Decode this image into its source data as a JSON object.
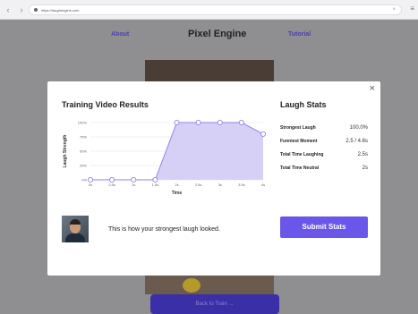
{
  "browser": {
    "url": "https://laughengine.com",
    "back_glyph": "‹",
    "forward_glyph": "›",
    "close_glyph": "×",
    "menu_glyph": "≡"
  },
  "page": {
    "nav_about": "About",
    "nav_title": "Pixel Engine",
    "nav_tutorial": "Tutorial",
    "bottom_button": "Back to Train →"
  },
  "modal": {
    "close_glyph": "×",
    "results_title": "Training Video Results",
    "stats_title": "Laugh Stats",
    "caption": "This is how your strongest laugh looked.",
    "submit_label": "Submit Stats",
    "stats": [
      {
        "label": "Strongest Laugh",
        "value": "100.0%"
      },
      {
        "label": "Funniest Moment",
        "value": "2.5 / 4.6s"
      },
      {
        "label": "Total Time Laughing",
        "value": "2.5s"
      },
      {
        "label": "Total Time Neutral",
        "value": "2s"
      }
    ]
  },
  "chart_data": {
    "type": "area",
    "xlabel": "Time",
    "ylabel": "Laugh Strength",
    "x": [
      "0s",
      "0.5s",
      "1s",
      "1.5s",
      "2s",
      "2.5s",
      "3s",
      "3.5s",
      "4s"
    ],
    "y_ticks": [
      "0%",
      "25%",
      "50%",
      "75%",
      "100%"
    ],
    "ylim": [
      0,
      100
    ],
    "values": [
      0,
      0,
      0,
      0,
      100,
      100,
      100,
      100,
      80
    ],
    "grid": true,
    "colors": {
      "fill": "#d6d0f7",
      "line": "#8f83e6",
      "marker_stroke": "#8f83e6",
      "grid": "#e3e3e3"
    }
  }
}
